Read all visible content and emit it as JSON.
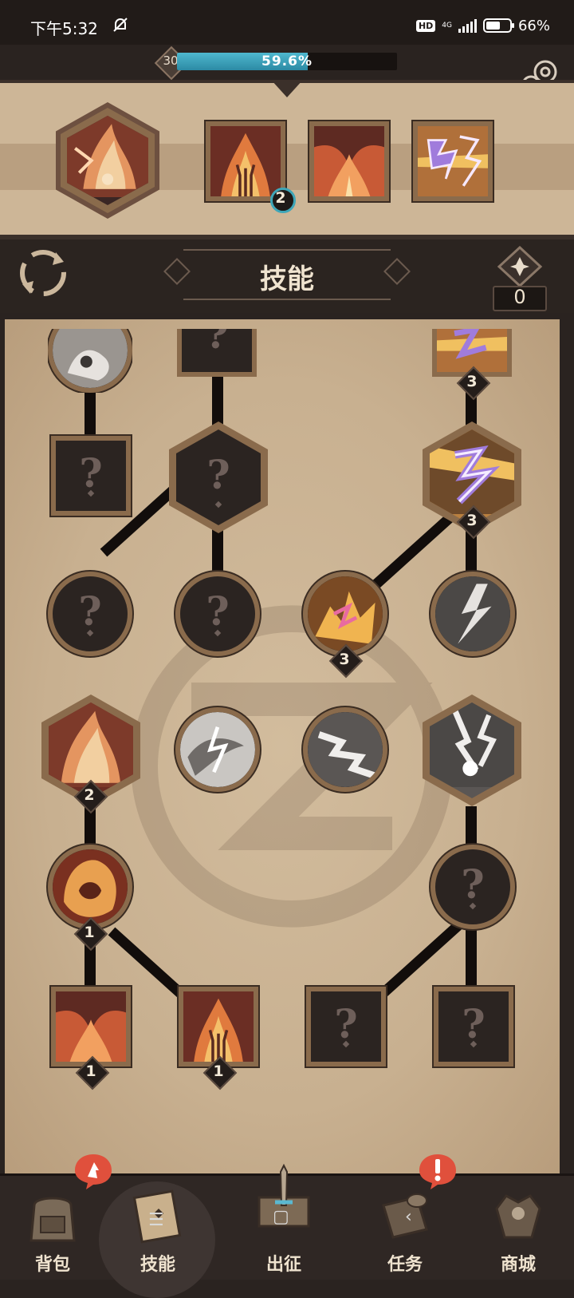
{
  "status_bar": {
    "time": "下午5:32",
    "network": "4G",
    "battery": "66%",
    "battery_level": 0.66,
    "hd_label": "HD"
  },
  "header": {
    "level": "30",
    "xp_text": "59.6%",
    "xp_fraction": 0.596,
    "settings_icon": "gear-icon"
  },
  "equipped": {
    "main_skill_icon": "fire-demon-icon",
    "slots": [
      {
        "icon": "flame-hand-icon",
        "count": "2"
      },
      {
        "icon": "fire-beast-icon",
        "count": ""
      },
      {
        "icon": "lightning-bolt-icon",
        "count": ""
      }
    ]
  },
  "title": {
    "text": "技能",
    "skill_points": "0",
    "refresh_icon": "refresh-icon",
    "points_icon": "compass-diamond-icon"
  },
  "skill_tree": {
    "nodes": [
      {
        "id": "r0c0",
        "shape": "circle",
        "state": "grey",
        "icon": "grey-beast-icon",
        "level": ""
      },
      {
        "id": "r0c1",
        "shape": "square",
        "state": "locked",
        "icon": "question-icon",
        "level": ""
      },
      {
        "id": "r0c3",
        "shape": "square",
        "state": "unlocked",
        "icon": "lightning-bolt-icon",
        "level": "3"
      },
      {
        "id": "r1c0",
        "shape": "square",
        "state": "locked",
        "icon": "question-icon",
        "level": ""
      },
      {
        "id": "r1c1",
        "shape": "hex",
        "state": "locked",
        "icon": "question-icon",
        "level": ""
      },
      {
        "id": "r1c3",
        "shape": "hex",
        "state": "unlocked",
        "icon": "purple-lightning-icon",
        "level": "3"
      },
      {
        "id": "r2c0",
        "shape": "circle",
        "state": "locked",
        "icon": "question-icon",
        "level": ""
      },
      {
        "id": "r2c1",
        "shape": "circle",
        "state": "locked",
        "icon": "question-icon",
        "level": ""
      },
      {
        "id": "r2c2",
        "shape": "circle",
        "state": "unlocked",
        "icon": "gold-lightning-icon",
        "level": "3"
      },
      {
        "id": "r2c3",
        "shape": "circle",
        "state": "grey",
        "icon": "grey-lightning-icon",
        "level": ""
      },
      {
        "id": "r3c0",
        "shape": "hex",
        "state": "unlocked",
        "icon": "fire-demon-icon",
        "level": "2"
      },
      {
        "id": "r3c1",
        "shape": "circle",
        "state": "grey",
        "icon": "grey-storm-icon",
        "level": ""
      },
      {
        "id": "r3c2",
        "shape": "circle",
        "state": "grey",
        "icon": "grey-zigzag-icon",
        "level": ""
      },
      {
        "id": "r3c3",
        "shape": "hex",
        "state": "grey",
        "icon": "grey-thunderball-icon",
        "level": ""
      },
      {
        "id": "r4c0",
        "shape": "circle",
        "state": "unlocked",
        "icon": "fire-lion-icon",
        "level": "1"
      },
      {
        "id": "r4c3",
        "shape": "circle",
        "state": "locked",
        "icon": "question-icon",
        "level": ""
      },
      {
        "id": "r5c0",
        "shape": "square",
        "state": "unlocked",
        "icon": "fire-beast-icon",
        "level": "1"
      },
      {
        "id": "r5c1",
        "shape": "square",
        "state": "unlocked",
        "icon": "flame-hand-icon",
        "level": "1"
      },
      {
        "id": "r5c2",
        "shape": "square",
        "state": "locked",
        "icon": "question-icon",
        "level": ""
      },
      {
        "id": "r5c3",
        "shape": "square",
        "state": "locked",
        "icon": "question-icon",
        "level": ""
      }
    ]
  },
  "bottom_nav": {
    "items": [
      {
        "label": "背包",
        "icon": "backpack-icon",
        "alert": "fire-alert-icon"
      },
      {
        "label": "技能",
        "icon": "skill-book-icon",
        "active": true
      },
      {
        "label": "出征",
        "icon": "sword-map-icon"
      },
      {
        "label": "任务",
        "icon": "scroll-icon",
        "alert": "exclamation-icon"
      },
      {
        "label": "商城",
        "icon": "merchant-icon"
      }
    ]
  },
  "colors": {
    "frame": "#2b2420",
    "parchment": "#c8b090",
    "node_border": "#8a6b4c",
    "xp_fill": "#3aa2bd",
    "alert_red": "#e0503c"
  }
}
